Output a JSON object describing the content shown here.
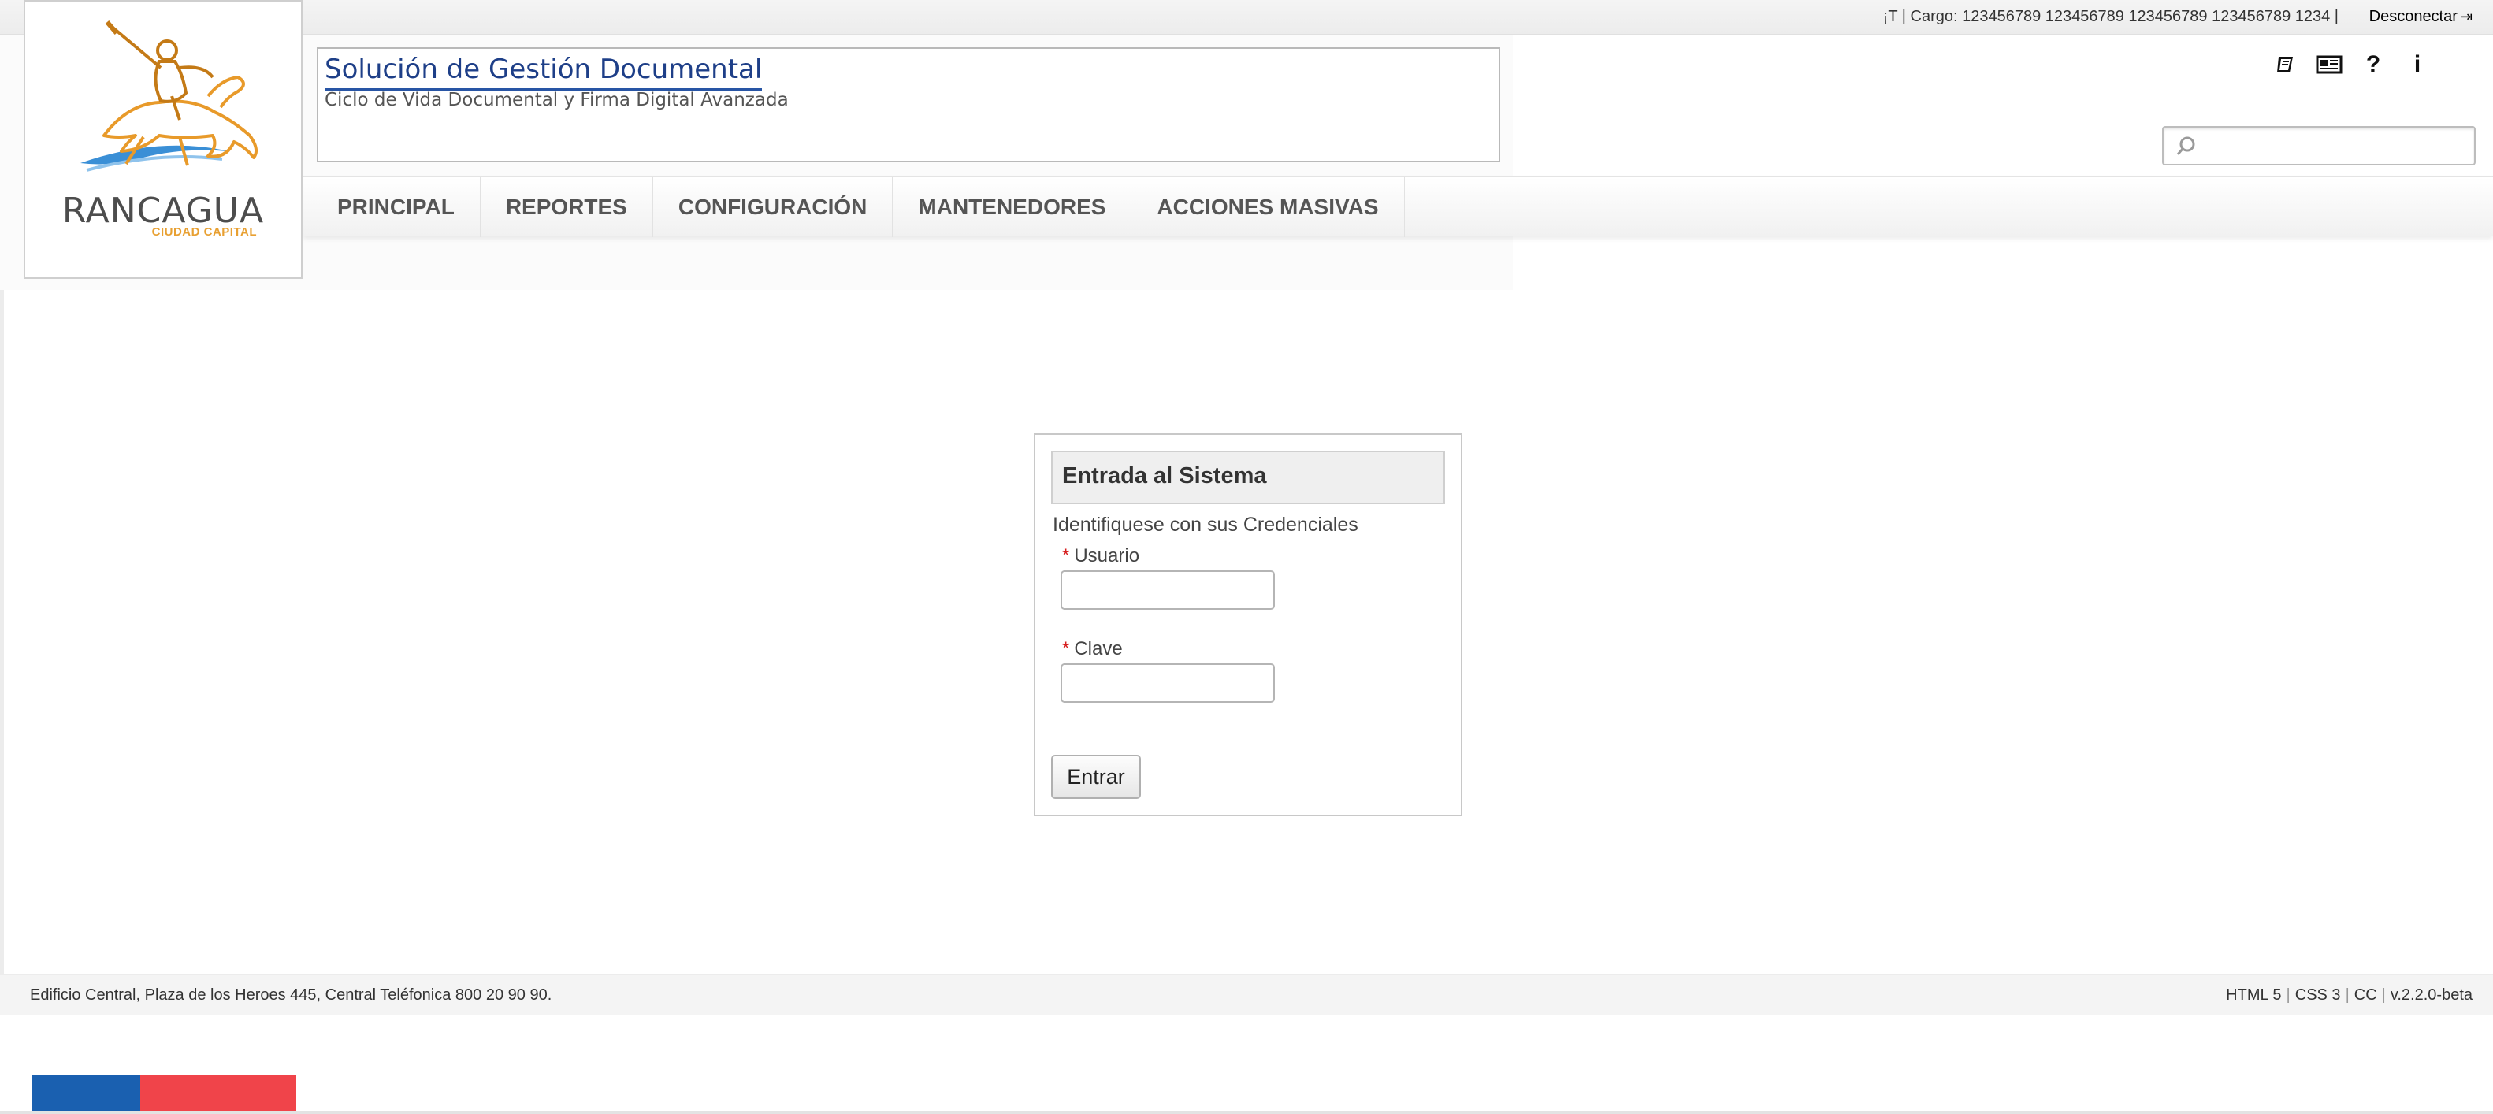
{
  "topbar": {
    "cargo_text": "¡T | Cargo: 123456789 123456789 123456789 123456789 1234 |",
    "logout_label": "Desconectar"
  },
  "logo": {
    "name": "RANCAGUA",
    "subtitle": "CIUDAD CAPITAL"
  },
  "header": {
    "title": "Solución de Gestión Documental",
    "subtitle": "Ciclo de Vida Documental y Firma Digital Avanzada"
  },
  "tools": [
    {
      "icon": "book-icon"
    },
    {
      "icon": "news-icon"
    },
    {
      "icon": "help-icon",
      "glyph": "?"
    },
    {
      "icon": "info-icon",
      "glyph": "i"
    }
  ],
  "search": {
    "placeholder": "",
    "value": ""
  },
  "nav": {
    "items": [
      {
        "label": "PRINCIPAL"
      },
      {
        "label": "REPORTES"
      },
      {
        "label": "CONFIGURACIÓN"
      },
      {
        "label": "MANTENEDORES"
      },
      {
        "label": "ACCIONES MASIVAS"
      }
    ]
  },
  "login": {
    "title": "Entrada al Sistema",
    "intro": "Identifiquese con sus Credenciales",
    "required_mark": "*",
    "user_label": "Usuario",
    "user_value": "",
    "password_label": "Clave",
    "password_value": "",
    "submit_label": "Entrar"
  },
  "footer": {
    "address": "Edificio Central, Plaza de los Heroes 445, Central Teléfonica 800 20 90 90.",
    "html": "HTML 5",
    "css": "CSS 3",
    "cc": "CC",
    "version": "v.2.2.0-beta"
  },
  "colors": {
    "title_blue": "#1e3f88",
    "required_red": "#d61f1f",
    "flag_blue": "#1a60b0",
    "flag_red": "#f0444a",
    "logo_orange": "#e8a032"
  }
}
